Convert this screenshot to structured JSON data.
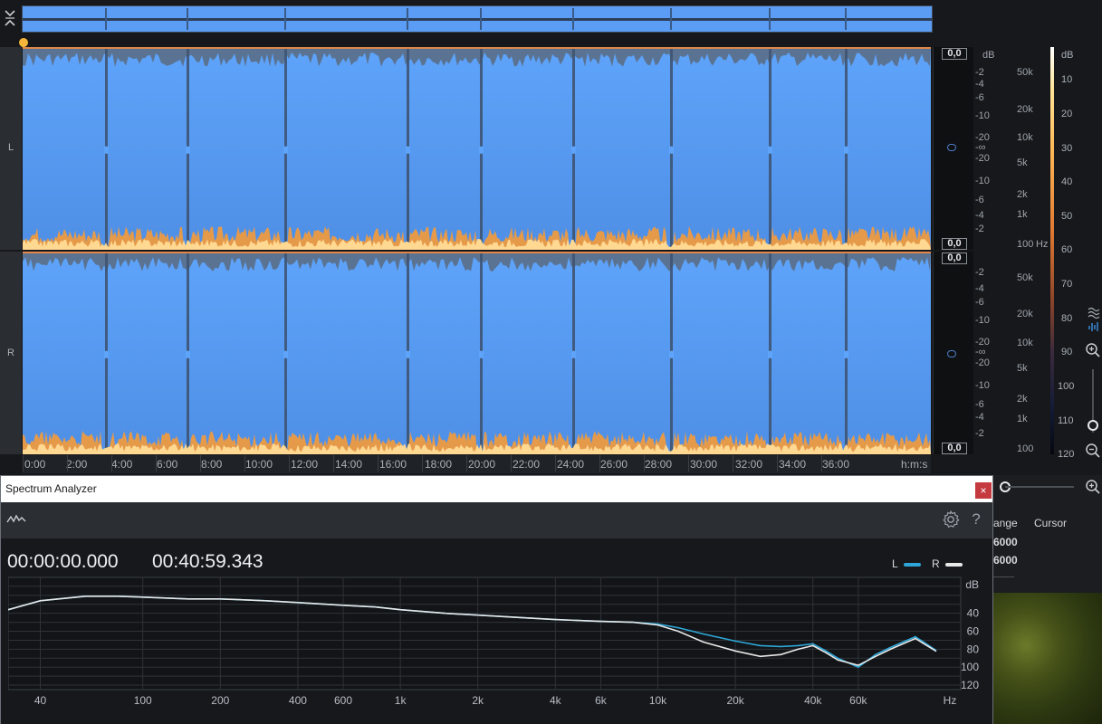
{
  "editor": {
    "channel_left_label": "L",
    "channel_right_label": "R",
    "meter_values": [
      "0,0",
      "0,0",
      "0,0",
      "0,0"
    ],
    "db_scale_top": [
      "dB",
      "-2",
      "-4",
      "-6",
      "-10",
      "-20",
      "-∞",
      "-20",
      "-10",
      "-6",
      "-4",
      "-2"
    ],
    "db_scale_bottom": [
      "-2",
      "-4",
      "-6",
      "-10",
      "-20",
      "-∞",
      "-20",
      "-10",
      "-6",
      "-4",
      "-2"
    ],
    "hz_scale_top": [
      "50k",
      "20k",
      "10k",
      "5k",
      "2k",
      "1k",
      "100",
      "Hz"
    ],
    "hz_scale_bottom": [
      "50k",
      "20k",
      "10k",
      "5k",
      "2k",
      "1k",
      "100"
    ],
    "color_scale": [
      "dB",
      "10",
      "20",
      "30",
      "40",
      "50",
      "60",
      "70",
      "80",
      "90",
      "100",
      "110",
      "120"
    ],
    "time_ticks": [
      "0:00",
      "2:00",
      "4:00",
      "6:00",
      "8:00",
      "10:00",
      "12:00",
      "14:00",
      "16:00",
      "18:00",
      "20:00",
      "22:00",
      "24:00",
      "26:00",
      "28:00",
      "30:00",
      "32:00",
      "34:00",
      "36:00"
    ],
    "time_unit": "h:m:s",
    "icons": {
      "collapse": "collapse-icon",
      "waveform_mode": "waveform-icon",
      "zoom_in": "zoom-in-icon",
      "zoom_out": "zoom-out-icon"
    }
  },
  "side_panel": {
    "range_header": "ange",
    "cursor_header": "Cursor",
    "values": [
      "6000",
      "6000"
    ]
  },
  "spectrum_window": {
    "title": "Spectrum Analyzer",
    "close_label": "×",
    "help_label": "?",
    "start_time": "00:00:00.000",
    "end_time": "00:40:59.343",
    "legend_left": "L",
    "legend_right": "R",
    "colors": {
      "left": "#2ea7d8",
      "right": "#e8e8e8"
    }
  },
  "chart_data": {
    "type": "line",
    "xlabel": "Hz",
    "ylabel": "dB",
    "x_scale": "log",
    "xlim": [
      30,
      150000
    ],
    "ylim": [
      125,
      0
    ],
    "x_ticks": [
      40,
      100,
      200,
      400,
      600,
      1000,
      2000,
      4000,
      6000,
      10000,
      20000,
      40000,
      60000
    ],
    "x_tick_labels": [
      "40",
      "100",
      "200",
      "400",
      "600",
      "1k",
      "2k",
      "4k",
      "6k",
      "10k",
      "20k",
      "40k",
      "60k"
    ],
    "y_ticks": [
      40,
      60,
      80,
      100,
      120
    ],
    "y_tick_labels": [
      "40",
      "60",
      "80",
      "100",
      "120"
    ],
    "grid": true,
    "legend": "top-right",
    "series": [
      {
        "name": "L",
        "x": [
          30,
          40,
          60,
          80,
          100,
          150,
          200,
          300,
          400,
          600,
          800,
          1000,
          1500,
          2000,
          3000,
          4000,
          6000,
          8000,
          10000,
          12000,
          15000,
          20000,
          25000,
          30000,
          35000,
          40000,
          45000,
          50000,
          60000,
          70000,
          80000,
          100000,
          120000
        ],
        "values": [
          36,
          26,
          21,
          21,
          22,
          24,
          24,
          26,
          28,
          31,
          33,
          36,
          40,
          42,
          45,
          47,
          49,
          50,
          52,
          56,
          63,
          71,
          76,
          77,
          76,
          74,
          82,
          90,
          100,
          86,
          78,
          66,
          81
        ]
      },
      {
        "name": "R",
        "x": [
          30,
          40,
          60,
          80,
          100,
          150,
          200,
          300,
          400,
          600,
          800,
          1000,
          1500,
          2000,
          3000,
          4000,
          6000,
          8000,
          10000,
          12000,
          15000,
          20000,
          25000,
          30000,
          35000,
          40000,
          45000,
          50000,
          60000,
          70000,
          80000,
          100000,
          120000
        ],
        "values": [
          36,
          26,
          21,
          21,
          22,
          24,
          24,
          26,
          28,
          31,
          33,
          36,
          40,
          42,
          45,
          47,
          49,
          50,
          53,
          60,
          72,
          82,
          88,
          86,
          80,
          76,
          84,
          92,
          98,
          88,
          80,
          68,
          82
        ]
      }
    ]
  }
}
